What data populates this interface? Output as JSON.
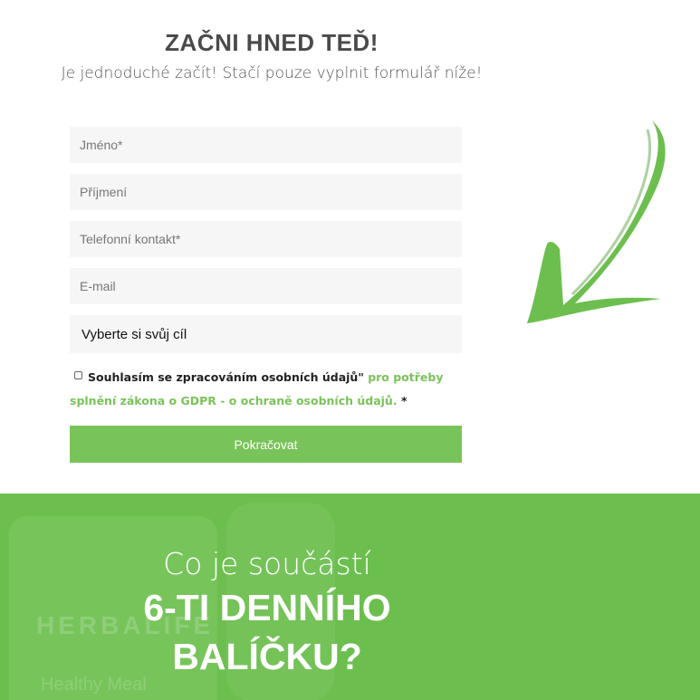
{
  "header": {
    "title": "ZAČNI HNED TEĎ!",
    "subtitle": "Je jednoduché začít! Stačí pouze vyplnit formulář níže!"
  },
  "form": {
    "first_name_placeholder": "Jméno*",
    "last_name_placeholder": "Příjmení",
    "phone_placeholder": "Telefonní kontakt*",
    "email_placeholder": "E-mail",
    "goal_select_value": "Vyberte si svůj cíl",
    "consent_part1": "Souhlasím se zpracováním osobních údajů\"",
    "consent_part2": "pro potřeby splnění zákona o GDPR - o ochraně osobních údajů.",
    "consent_required_mark": "*",
    "submit_label": "Pokračovat"
  },
  "banner": {
    "subtitle": "Co je součástí",
    "title_line1": "6-TI DENNÍHO",
    "title_line2": "BALÍČKU?",
    "background_brand": "HERBALIFE",
    "background_product": "Healthy Meal"
  },
  "colors": {
    "accent_green": "#79c45a",
    "banner_green": "#6cbf4e",
    "field_background": "#f6f6f6"
  },
  "icons": {
    "arrow": "brush-arrow-down-left-icon"
  }
}
